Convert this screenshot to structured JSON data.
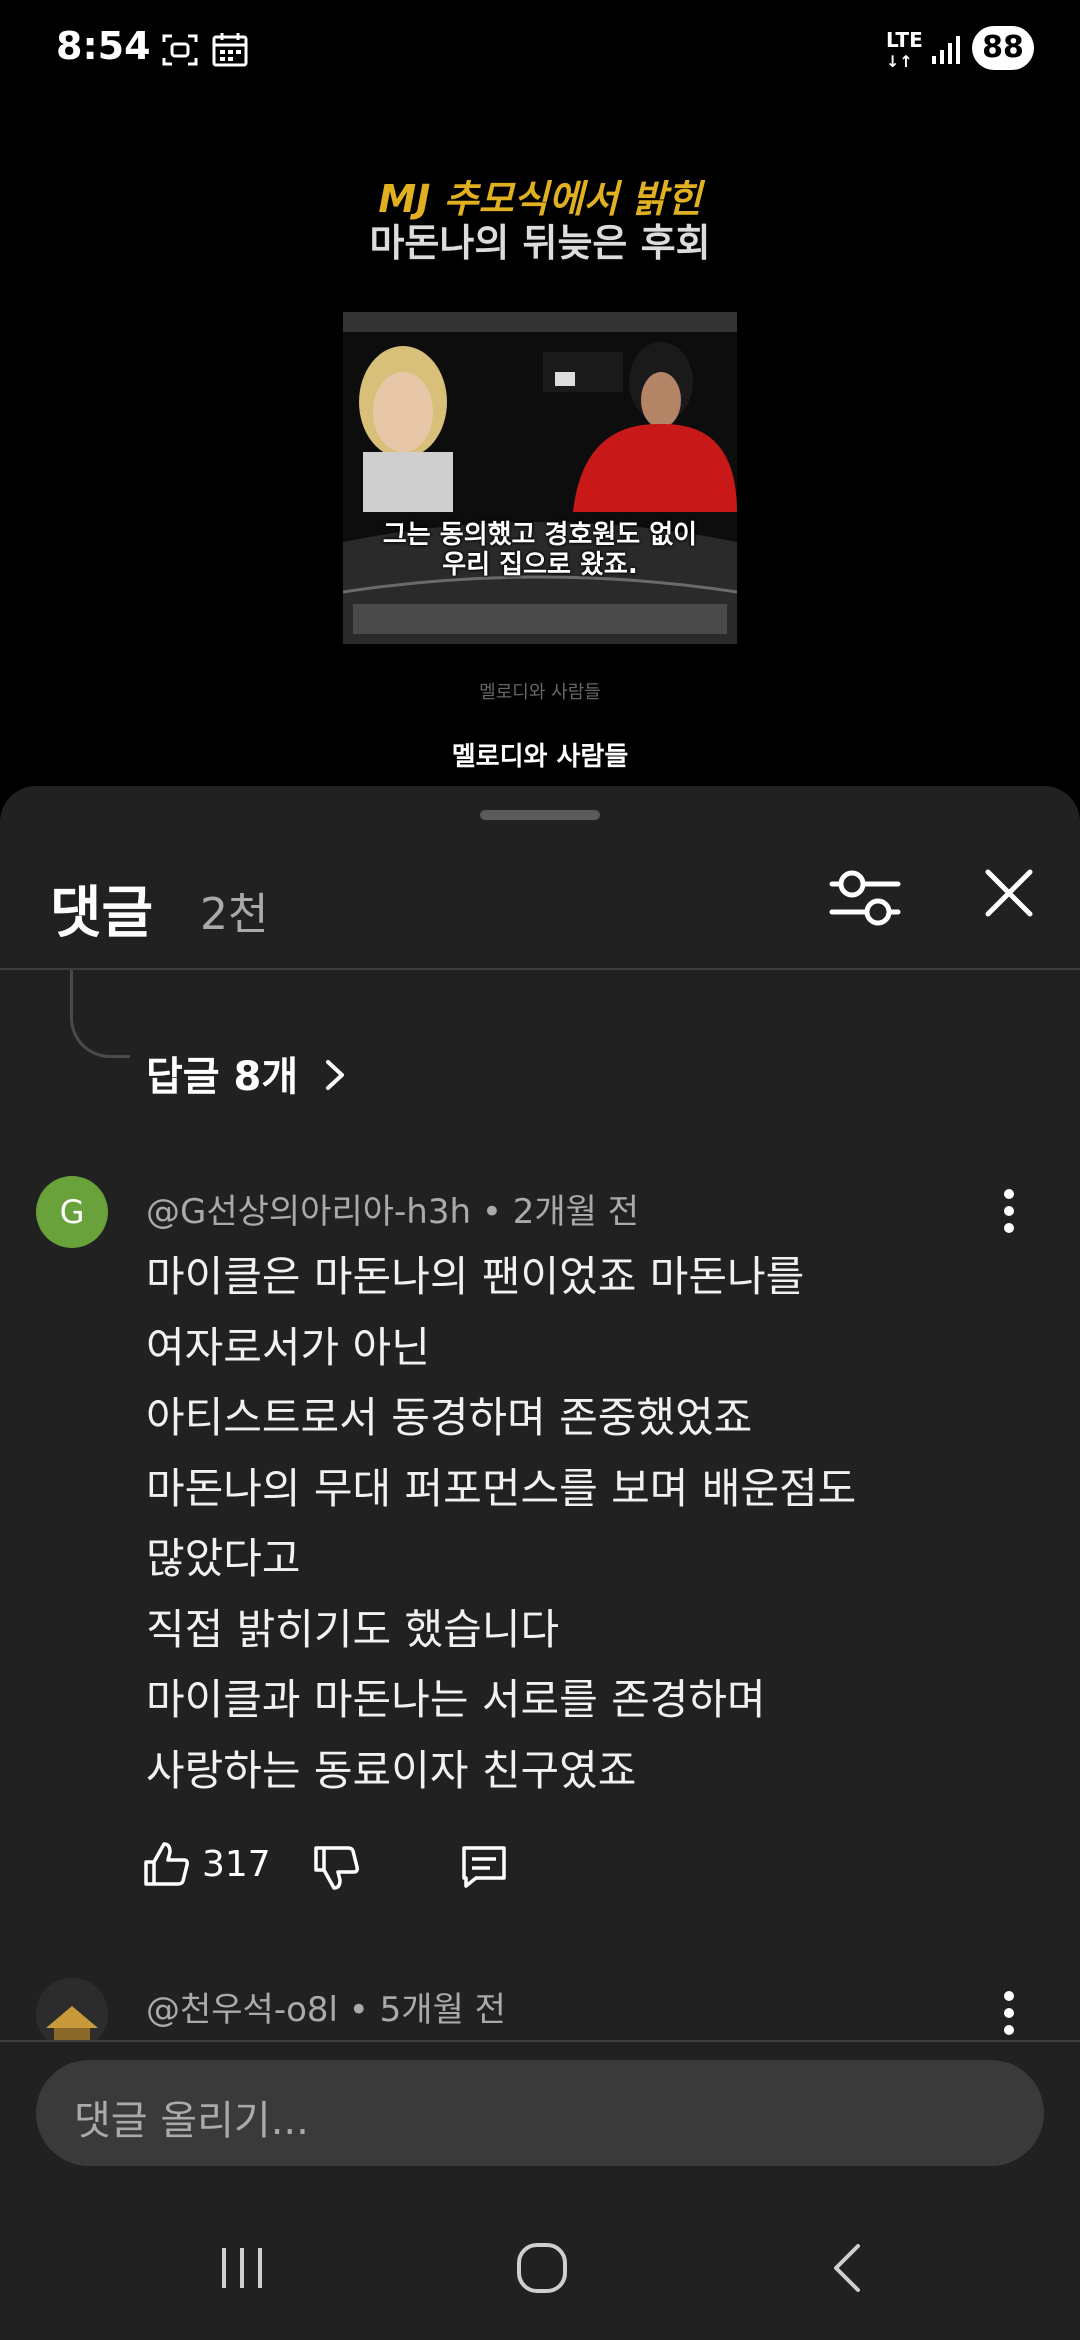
{
  "status_bar": {
    "time": "8:54",
    "network": "LTE",
    "battery": "88",
    "icons": [
      "screenshot-icon",
      "calendar-icon",
      "signal-icon"
    ]
  },
  "video": {
    "title_line1": "MJ 추모식에서 밝힌",
    "title_line2": "마돈나의 뒤늦은 후회",
    "caption_line1": "그는 동의했고 경호원도 없이",
    "caption_line2": "우리 집으로 왔죠.",
    "channel_small": "멜로디와 사람들",
    "channel_logo": "멜로디와 사람들"
  },
  "comments_panel": {
    "title": "댓글",
    "count": "2천",
    "replies_label": "답글 8개"
  },
  "comments": [
    {
      "avatar_letter": "G",
      "avatar_color": "#69a23a",
      "meta": "@G선상의아리아-h3h • 2개월 전",
      "lines": [
        "마이클은 마돈나의 팬이었죠 마돈나를",
        "여자로서가 아닌",
        "아티스트로서 동경하며 존중했었죠",
        "마돈나의 무대 퍼포먼스를 보며 배운점도",
        "많았다고",
        "직접 밝히기도 했습니다",
        "마이클과 마돈나는 서로를 존경하며",
        "사랑하는 동료이자 친구였죠"
      ],
      "likes": "317"
    },
    {
      "meta": "@천우석-o8l • 5개월 전"
    }
  ],
  "input": {
    "placeholder": "댓글 올리기..."
  },
  "colors": {
    "sheet_bg": "#212121",
    "title_gold": "#e0b020",
    "input_bg": "#3a3a3a"
  }
}
